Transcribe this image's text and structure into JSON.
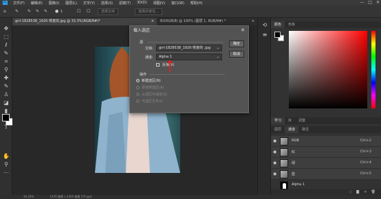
{
  "menubar": {
    "logo": "Ps",
    "items": [
      "文件(F)",
      "编辑(E)",
      "图像(I)",
      "图层(L)",
      "文字(Y)",
      "选择(S)",
      "滤镜(T)",
      "3D(D)",
      "视图(V)",
      "窗口(W)",
      "帮助(H)"
    ],
    "minimize": "—",
    "maximize": "□",
    "close": "✕"
  },
  "optbar": {
    "brush_size": "1",
    "btn_select_subject": "选择主体",
    "btn_select_mask": "选择并遮住..."
  },
  "tabs": [
    {
      "label": "girl-1828538_1920-恢复的.jpg @ 33.3%(RGB/8#)*",
      "close": "×"
    },
    {
      "label": "3D(RGB/8) @ 100% (图层 1, RGB/8#) *",
      "close": "×"
    }
  ],
  "status": {
    "zoom": "33.33%",
    "size": "1470 像素 x 2205 像素 (72 ppi)"
  },
  "panels": {
    "color_tabs": [
      "颜色",
      "色板"
    ],
    "channel_tabs": [
      "学习",
      "库",
      "调整"
    ],
    "layer_tabs": [
      "图层",
      "通道",
      "路径"
    ],
    "channels": [
      {
        "name": "RGB",
        "shortcut": "Ctrl+2"
      },
      {
        "name": "红",
        "shortcut": "Ctrl+3"
      },
      {
        "name": "绿",
        "shortcut": "Ctrl+4"
      },
      {
        "name": "蓝",
        "shortcut": "Ctrl+5"
      },
      {
        "name": "Alpha 1",
        "shortcut": ""
      }
    ]
  },
  "dialog": {
    "title": "载入选区",
    "close": "✕",
    "source_heading": "源",
    "doc_label": "文档:",
    "doc_value": "girl-1828538_1920-恢复的 .jpg",
    "channel_label": "通道:",
    "channel_value": "Alpha 1",
    "invert_label": "反相(V)",
    "ok_label": "确定",
    "cancel_label": "取消",
    "operation_heading": "操作",
    "operations": [
      "新建选区(N)",
      "添加到选区(A)",
      "从选区中减去(S)",
      "与选区交叉(I)"
    ],
    "selected_operation": 0
  },
  "colors": {
    "accent": "#31a8ff",
    "annotation": "#e02020"
  }
}
